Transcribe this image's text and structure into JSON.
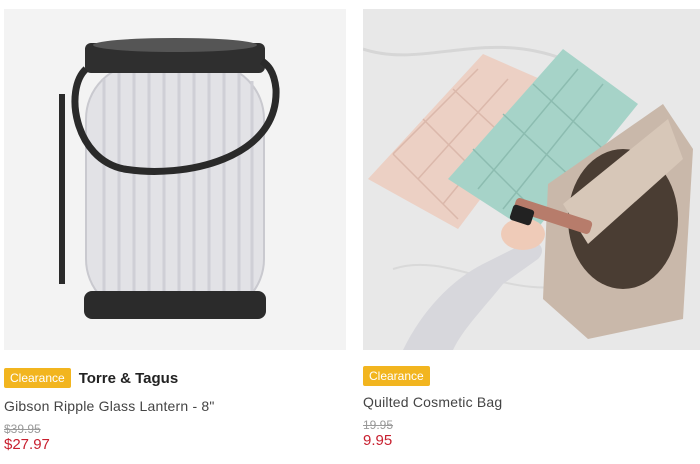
{
  "products": [
    {
      "badge": "Clearance",
      "brand": "Torre & Tagus",
      "name": "Gibson Ripple Glass Lantern - 8\"",
      "old_price": "$39.95",
      "price": "$27.97"
    },
    {
      "badge": "Clearance",
      "brand": "",
      "name": "Quilted Cosmetic Bag",
      "old_price": "19.95",
      "price": "9.95"
    }
  ],
  "colors": {
    "badge": "#f2b51f",
    "price": "#c8202f"
  }
}
